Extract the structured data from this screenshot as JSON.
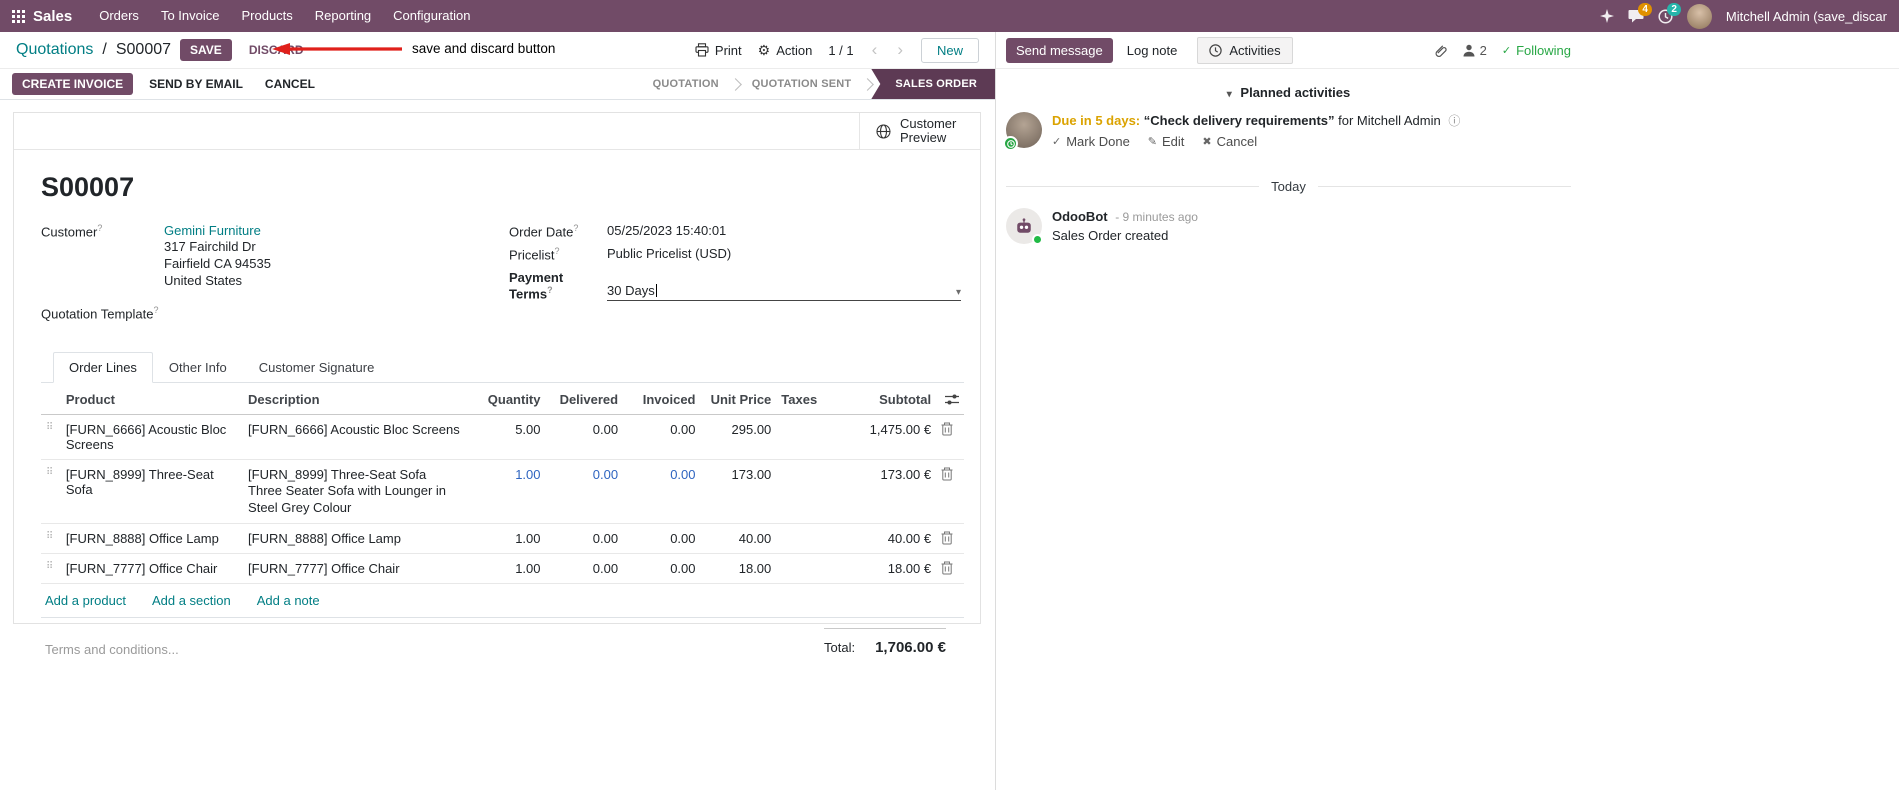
{
  "colors": {
    "primary": "#714B67",
    "accent": "#017E84",
    "stage_active": "#5d3a54",
    "edited": "#2e64c0",
    "arrow": "#e0201b",
    "due": "#dba301",
    "following": "#28a745",
    "badge_msg": "#e19100",
    "badge_act": "#26b5ab"
  },
  "icons": {
    "prev": "‹",
    "next": "›",
    "gear": "⚙",
    "caret": "▾",
    "drag": "⠿",
    "check": "✓",
    "edit": "✎",
    "cancel": "✖",
    "info": "ⓘ"
  },
  "navbar": {
    "brand": "Sales",
    "menus": [
      "Orders",
      "To Invoice",
      "Products",
      "Reporting",
      "Configuration"
    ],
    "messages_count": "4",
    "activities_count": "2",
    "user_name": "Mitchell Admin (save_discar"
  },
  "control_panel": {
    "breadcrumb_parent": "Quotations",
    "separator": "/",
    "breadcrumb_current": "S00007",
    "save_label": "SAVE",
    "discard_label": "DISCARD",
    "annotation_text": "save and discard button",
    "print_label": "Print",
    "action_label": "Action",
    "pager": "1 / 1",
    "new_label": "New"
  },
  "statusbar": {
    "buttons": [
      "CREATE INVOICE",
      "SEND BY EMAIL",
      "CANCEL"
    ],
    "stages": [
      "QUOTATION",
      "QUOTATION SENT",
      "SALES ORDER"
    ],
    "active_stage": "SALES ORDER"
  },
  "sheet": {
    "preview_button": "Customer Preview",
    "title": "S00007",
    "help_marker": "?",
    "customer_label": "Customer",
    "customer_value": "Gemini Furniture",
    "address_lines": [
      "317 Fairchild Dr",
      "Fairfield CA 94535",
      "United States"
    ],
    "template_label": "Quotation Template",
    "order_date_label": "Order Date",
    "order_date_value": "05/25/2023 15:40:01",
    "pricelist_label": "Pricelist",
    "pricelist_value": "Public Pricelist (USD)",
    "payment_terms_label": "Payment Terms",
    "payment_terms_value": "30 Days"
  },
  "tabs": [
    "Order Lines",
    "Other Info",
    "Customer Signature"
  ],
  "order_lines": {
    "headers": {
      "product": "Product",
      "description": "Description",
      "quantity": "Quantity",
      "delivered": "Delivered",
      "invoiced": "Invoiced",
      "unit_price": "Unit Price",
      "taxes": "Taxes",
      "subtotal": "Subtotal"
    },
    "rows": [
      {
        "product": "[FURN_6666] Acoustic Bloc Screens",
        "description": "[FURN_6666] Acoustic Bloc Screens",
        "quantity": "5.00",
        "delivered": "0.00",
        "invoiced": "0.00",
        "unit_price": "295.00",
        "taxes": "",
        "subtotal": "1,475.00 €"
      },
      {
        "product": "[FURN_8999] Three-Seat Sofa",
        "description": "[FURN_8999] Three-Seat Sofa",
        "description2": "Three Seater Sofa with Lounger in Steel Grey Colour",
        "quantity": "1.00",
        "delivered": "0.00",
        "invoiced": "0.00",
        "unit_price": "173.00",
        "taxes": "",
        "subtotal": "173.00 €"
      },
      {
        "product": "[FURN_8888] Office Lamp",
        "description": "[FURN_8888] Office Lamp",
        "quantity": "1.00",
        "delivered": "0.00",
        "invoiced": "0.00",
        "unit_price": "40.00",
        "taxes": "",
        "subtotal": "40.00 €"
      },
      {
        "product": "[FURN_7777] Office Chair",
        "description": "[FURN_7777] Office Chair",
        "quantity": "1.00",
        "delivered": "0.00",
        "invoiced": "0.00",
        "unit_price": "18.00",
        "taxes": "",
        "subtotal": "18.00 €"
      }
    ],
    "links": [
      "Add a product",
      "Add a section",
      "Add a note"
    ],
    "terms_placeholder": "Terms and conditions...",
    "total_label": "Total:",
    "total_value": "1,706.00 €"
  },
  "chatter": {
    "send_message": "Send message",
    "log_note": "Log note",
    "activities_tab": "Activities",
    "followers_count": "2",
    "following_label": "Following",
    "planned_header": "Planned activities",
    "activity": {
      "due": "Due in 5 days:",
      "summary": "“Check delivery requirements”",
      "for_text": "for Mitchell Admin",
      "mark_done": "Mark Done",
      "edit": "Edit",
      "cancel": "Cancel"
    },
    "today_label": "Today",
    "message": {
      "author": "OdooBot",
      "time": "- 9 minutes ago",
      "body": "Sales Order created"
    }
  }
}
